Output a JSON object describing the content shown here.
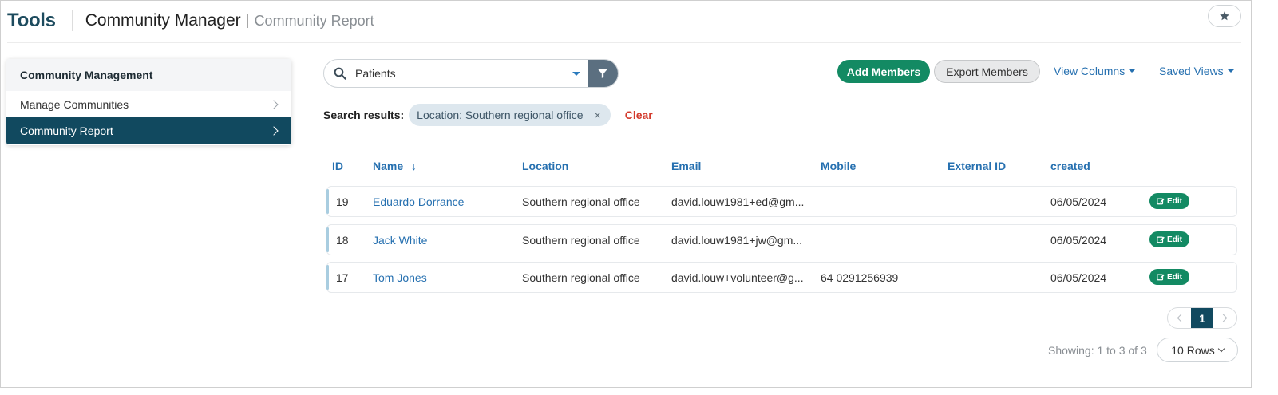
{
  "header": {
    "brand": "Tools",
    "app_title": "Community Manager",
    "separator": "|",
    "breadcrumb": "Community Report"
  },
  "sidebar": {
    "heading": "Community Management",
    "items": [
      {
        "label": "Manage Communities",
        "active": false
      },
      {
        "label": "Community Report",
        "active": true
      }
    ]
  },
  "search": {
    "value": "Patients",
    "icon": "search-icon",
    "filter_icon": "filter-icon"
  },
  "actions": {
    "add_members": "Add Members",
    "export_members": "Export Members",
    "view_columns": "View Columns",
    "saved_views": "Saved Views"
  },
  "results": {
    "label": "Search results:",
    "chip": "Location: Southern regional office",
    "chip_remove": "×",
    "clear": "Clear"
  },
  "table": {
    "columns": [
      "ID",
      "Name",
      "Location",
      "Email",
      "Mobile",
      "External ID",
      "created"
    ],
    "sort_indicator": "↓",
    "rows": [
      {
        "id": "19",
        "name": "Eduardo Dorrance",
        "location": "Southern regional office",
        "email": "david.louw1981+ed@gm...",
        "mobile": "",
        "external_id": "",
        "created": "06/05/2024"
      },
      {
        "id": "18",
        "name": "Jack White",
        "location": "Southern regional office",
        "email": "david.louw1981+jw@gm...",
        "mobile": "",
        "external_id": "",
        "created": "06/05/2024"
      },
      {
        "id": "17",
        "name": "Tom Jones",
        "location": "Southern regional office",
        "email": "david.louw+volunteer@g...",
        "mobile": "64 0291256939",
        "external_id": "",
        "created": "06/05/2024"
      }
    ],
    "edit_label": "Edit"
  },
  "pagination": {
    "current_page": "1",
    "showing": "Showing: 1 to 3 of 3",
    "rows_per_page": "10 Rows"
  },
  "colors": {
    "brand": "#1d4b5e",
    "primary_green": "#138a63",
    "active_nav": "#11495f",
    "link": "#2670b0",
    "danger": "#d33a2c"
  }
}
